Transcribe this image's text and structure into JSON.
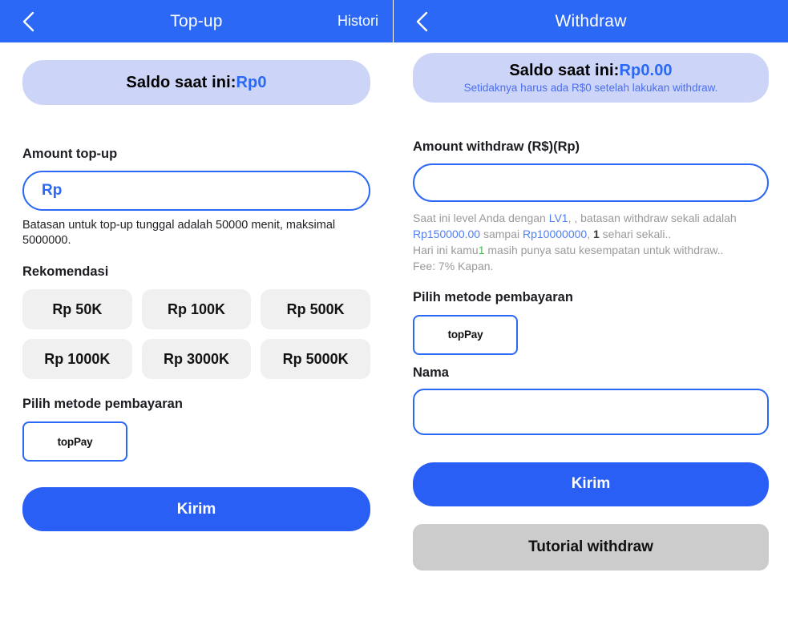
{
  "topup": {
    "header": {
      "back_icon": "chevron-left-icon",
      "title": "Top-up",
      "action_label": "Histori"
    },
    "balance": {
      "label": "Saldo saat ini:",
      "amount": "Rp0"
    },
    "amount": {
      "label": "Amount top-up",
      "placeholder": "Rp",
      "value": "",
      "hint": "Batasan untuk top-up tunggal adalah 50000 menit, maksimal 5000000."
    },
    "recommend": {
      "label": "Rekomendasi",
      "options": [
        "Rp 50K",
        "Rp 100K",
        "Rp 500K",
        "Rp 1000K",
        "Rp 3000K",
        "Rp 5000K"
      ]
    },
    "payment": {
      "label": "Pilih metode pembayaran",
      "methods": [
        "topPay"
      ]
    },
    "submit_label": "Kirim"
  },
  "withdraw": {
    "header": {
      "back_icon": "chevron-left-icon",
      "title": "Withdraw"
    },
    "balance": {
      "label": "Saldo saat ini:",
      "amount": "Rp0.00",
      "note": "Setidaknya harus ada R$0 setelah lakukan withdraw."
    },
    "amount": {
      "label": "Amount withdraw (R$)(Rp)",
      "placeholder": "",
      "value": ""
    },
    "info": {
      "line1_a": "Saat ini level Anda dengan ",
      "line1_level": "LV1",
      "line1_b": ", , batasan withdraw sekali adalah ",
      "line2_min": "Rp150000.00",
      "line2_mid": " sampai ",
      "line2_max": "Rp10000000",
      "line2_sep": ", ",
      "line2_count": "1",
      "line2_tail": " sehari sekali..",
      "line3_a": "Hari ini kamu",
      "line3_count": "1",
      "line3_b": " masih punya satu kesempatan untuk withdraw..",
      "line4": "Fee: 7% Kapan."
    },
    "payment": {
      "label": "Pilih metode pembayaran",
      "methods": [
        "topPay"
      ]
    },
    "nama": {
      "label": "Nama",
      "placeholder": "",
      "value": ""
    },
    "submit_label": "Kirim",
    "tutorial_label": "Tutorial withdraw"
  },
  "colors": {
    "primary": "#2a68f5",
    "banner": "#ccd5f7",
    "chip": "#f0f0f0",
    "grey_button": "#cccccc",
    "info_blue": "#4f7ef5",
    "info_green": "#3cc04a"
  }
}
